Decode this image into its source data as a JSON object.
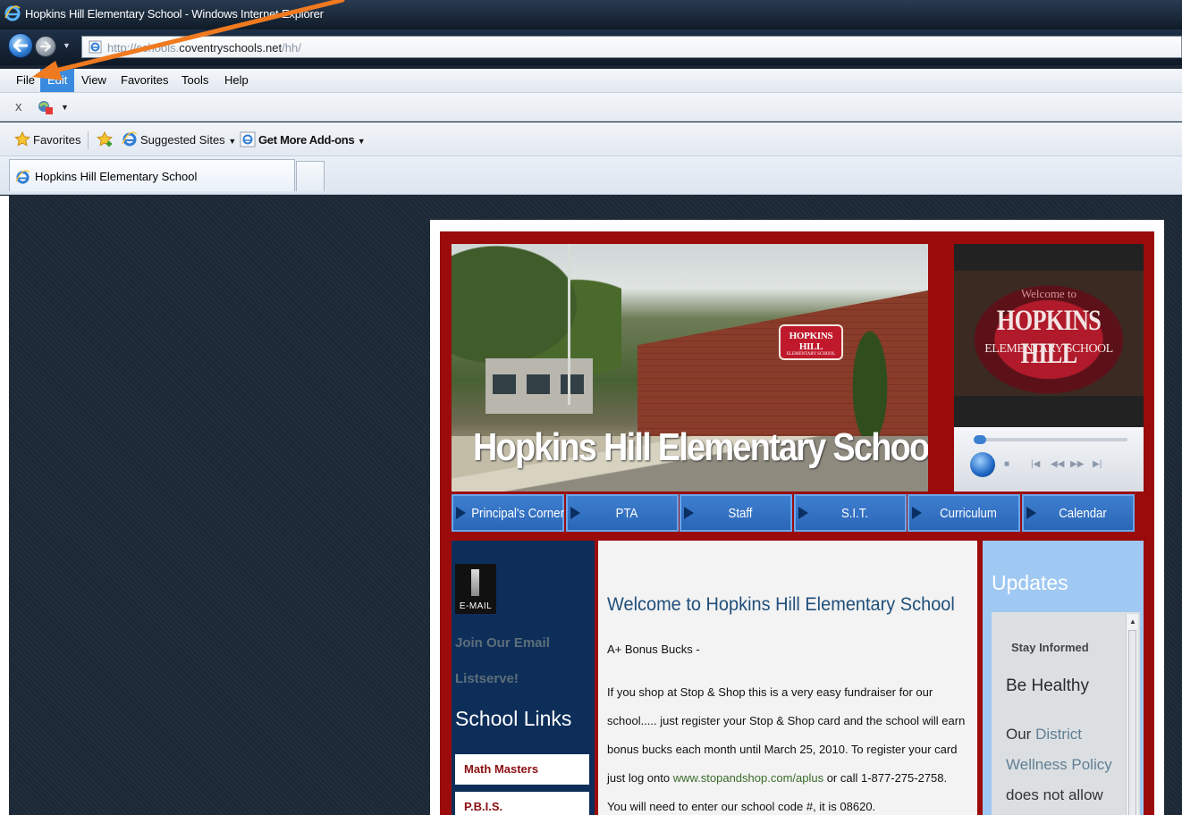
{
  "window": {
    "title": "Hopkins Hill Elementary School - Windows Internet Explorer"
  },
  "address": {
    "url_prefix": "http://schools.",
    "url_domain": "coventryschools.net",
    "url_path": "/hh/"
  },
  "menu": [
    "File",
    "Edit",
    "View",
    "Favorites",
    "Tools",
    "Help"
  ],
  "menu_active": "Edit",
  "command_bar": {
    "close_glyph": "x"
  },
  "favorites_bar": {
    "favorites_label": "Favorites",
    "suggested_sites_label": "Suggested Sites",
    "addons_label": "Get More Add-ons"
  },
  "tab": {
    "title": "Hopkins Hill Elementary School"
  },
  "site": {
    "hero_title": "Hopkins Hill Elementary School",
    "hero_sign_line1": "HOPKINS HILL",
    "hero_sign_line2": "ELEMENTARY SCHOOL",
    "video_sign_line0": "Welcome to",
    "video_sign_line1": "HOPKINS HILL",
    "video_sign_line2": "ELEMENTARY SCHOOL",
    "nav": [
      "Principal's Corner",
      "PTA",
      "Staff",
      "S.I.T.",
      "Curriculum",
      "Calendar"
    ],
    "email_icon_label": "E-MAIL",
    "join_link": "Join Our Email Listserve!",
    "school_links_heading": "School Links",
    "school_links": [
      "Math Masters",
      "P.B.I.S."
    ],
    "welcome_heading": "Welcome to Hopkins Hill Elementary School",
    "bonus_heading": "A+ Bonus Bucks -",
    "body_before_link": "If you shop at Stop & Shop this is a very easy fundraiser for our school..... just register your Stop & Shop card and the school will earn bonus bucks each month until March 25, 2010. To register your card just log onto ",
    "body_link": "www.stopandshop.com/aplus",
    "body_after_link": " or call 1-877-275-2758. You will need to enter our school code #, it is 08620.",
    "updates_heading": "Updates",
    "stay_informed": "Stay Informed",
    "be_healthy": "Be Healthy",
    "district_our": "Our",
    "district_link": "District Wellness Policy",
    "district_tail": "does not allow"
  },
  "colors": {
    "site_frame": "#9b0b0b",
    "nav_button": "#3576c8",
    "left_column": "#0e2e5a",
    "updates_column": "#9fc8f2",
    "annotation_arrow": "#f07a1f"
  }
}
